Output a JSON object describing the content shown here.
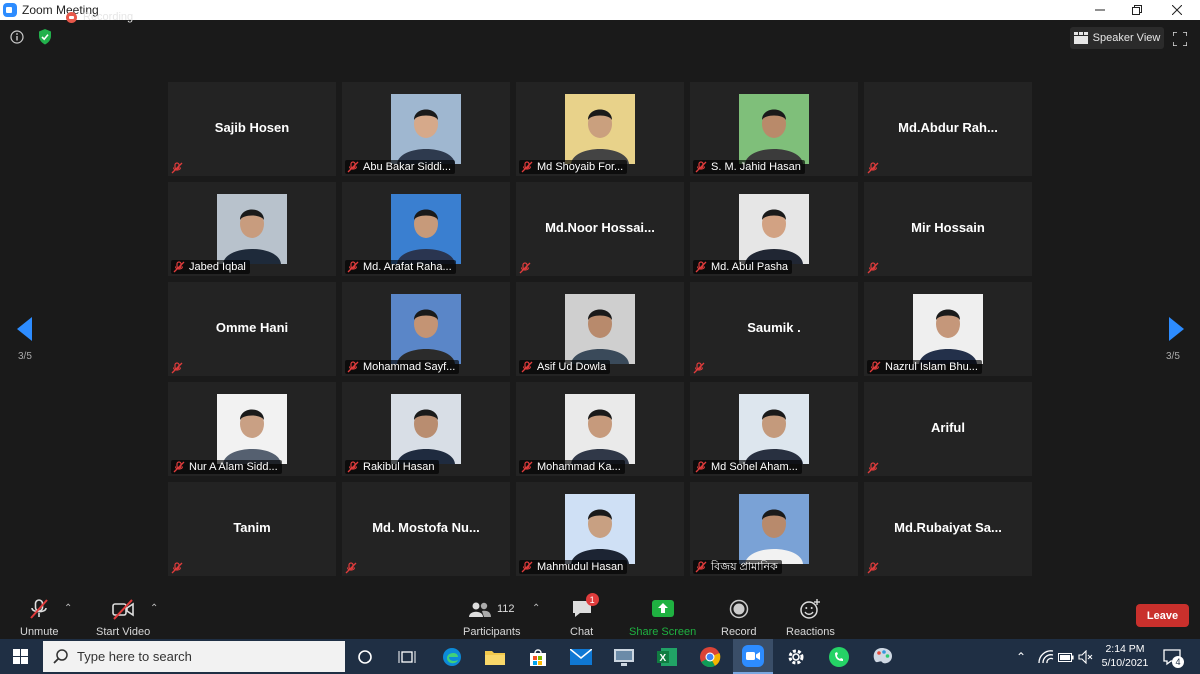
{
  "window": {
    "title": "Zoom Meeting"
  },
  "meeting": {
    "recording_label": "Recording",
    "speaker_view_label": "Speaker View"
  },
  "navigation": {
    "page_left": "3/5",
    "page_right": "3/5"
  },
  "participants": [
    {
      "name": "Sajib Hosen",
      "video": false
    },
    {
      "name": "Abu Bakar Siddi...",
      "video": true
    },
    {
      "name": "Md Shoyaib For...",
      "video": true
    },
    {
      "name": "S. M. Jahid Hasan",
      "video": true
    },
    {
      "name": "Md.Abdur  Rah...",
      "video": false
    },
    {
      "name": "Jabed Iqbal",
      "video": true
    },
    {
      "name": "Md. Arafat Raha...",
      "video": true
    },
    {
      "name": "Md.Noor  Hossai...",
      "video": false
    },
    {
      "name": "Md. Abul Pasha",
      "video": true
    },
    {
      "name": "Mir Hossain",
      "video": false
    },
    {
      "name": "Omme Hani",
      "video": false
    },
    {
      "name": "Mohammad Sayf...",
      "video": true
    },
    {
      "name": "Asif Ud Dowla",
      "video": true
    },
    {
      "name": "Saumik .",
      "video": false
    },
    {
      "name": "Nazrul Islam Bhu...",
      "video": true
    },
    {
      "name": "Nur A Alam Sidd...",
      "video": true
    },
    {
      "name": "Rakibul Hasan",
      "video": true
    },
    {
      "name": "Mohammad Ka...",
      "video": true
    },
    {
      "name": "Md Sohel Aham...",
      "video": true
    },
    {
      "name": "Ariful",
      "video": false
    },
    {
      "name": "Tanim",
      "video": false
    },
    {
      "name": "Md.  Mostofa  Nu...",
      "video": false
    },
    {
      "name": "Mahmudul Hasan",
      "video": true
    },
    {
      "name": "বিজয় প্রামানিক",
      "video": true
    },
    {
      "name": "Md.Rubaiyat  Sa...",
      "video": false
    }
  ],
  "toolbar": {
    "unmute": "Unmute",
    "start_video": "Start Video",
    "participants": "Participants",
    "participants_count": "112",
    "chat": "Chat",
    "chat_badge": "1",
    "share_screen": "Share Screen",
    "record": "Record",
    "reactions": "Reactions",
    "leave": "Leave"
  },
  "taskbar": {
    "search_placeholder": "Type here to search",
    "time": "2:14 PM",
    "date": "5/10/2021",
    "notification_count": "4"
  },
  "colors": {
    "accent": "#2d8cff",
    "share": "#1fb141",
    "leave": "#c9302c",
    "taskbar": "#1f2f44"
  }
}
